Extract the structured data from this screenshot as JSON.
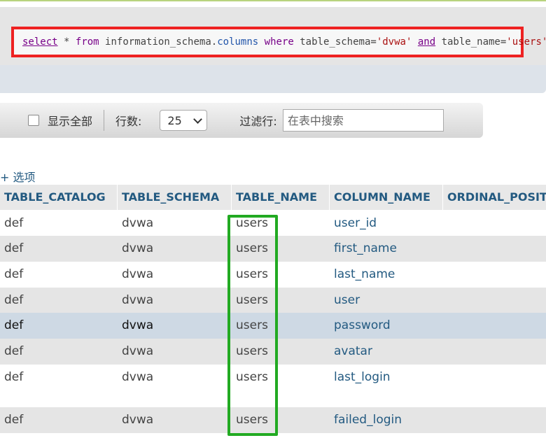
{
  "query": {
    "select_kw": "select",
    "star": "*",
    "from_kw": "from",
    "schema_table": "information_schema.",
    "columns_word": "columns",
    "where_kw": "where",
    "cond1_col": "table_schema=",
    "cond1_val": "'dvwa'",
    "and_kw": "and",
    "cond2_col": "table_name=",
    "cond2_val": "'users'"
  },
  "controls": {
    "show_all_label": "显示全部",
    "rows_label": "行数:",
    "rows_value": "25",
    "filter_label": "过滤行:",
    "filter_placeholder": "在表中搜索"
  },
  "options_link": "+ 选项",
  "table": {
    "headers": [
      "TABLE_CATALOG",
      "TABLE_SCHEMA",
      "TABLE_NAME",
      "COLUMN_NAME",
      "ORDINAL_POSIT"
    ],
    "rows": [
      [
        "def",
        "dvwa",
        "users",
        "user_id"
      ],
      [
        "def",
        "dvwa",
        "users",
        "first_name"
      ],
      [
        "def",
        "dvwa",
        "users",
        "last_name"
      ],
      [
        "def",
        "dvwa",
        "users",
        "user"
      ],
      [
        "def",
        "dvwa",
        "users",
        "password"
      ],
      [
        "def",
        "dvwa",
        "users",
        "avatar"
      ],
      [
        "def",
        "dvwa",
        "users",
        "last_login"
      ],
      [
        "def",
        "dvwa",
        "users",
        "failed_login"
      ]
    ]
  },
  "colors": {
    "sql_highlight_border": "#ee2222",
    "column_highlight_border": "#22aa22",
    "link_color": "#235a81"
  }
}
